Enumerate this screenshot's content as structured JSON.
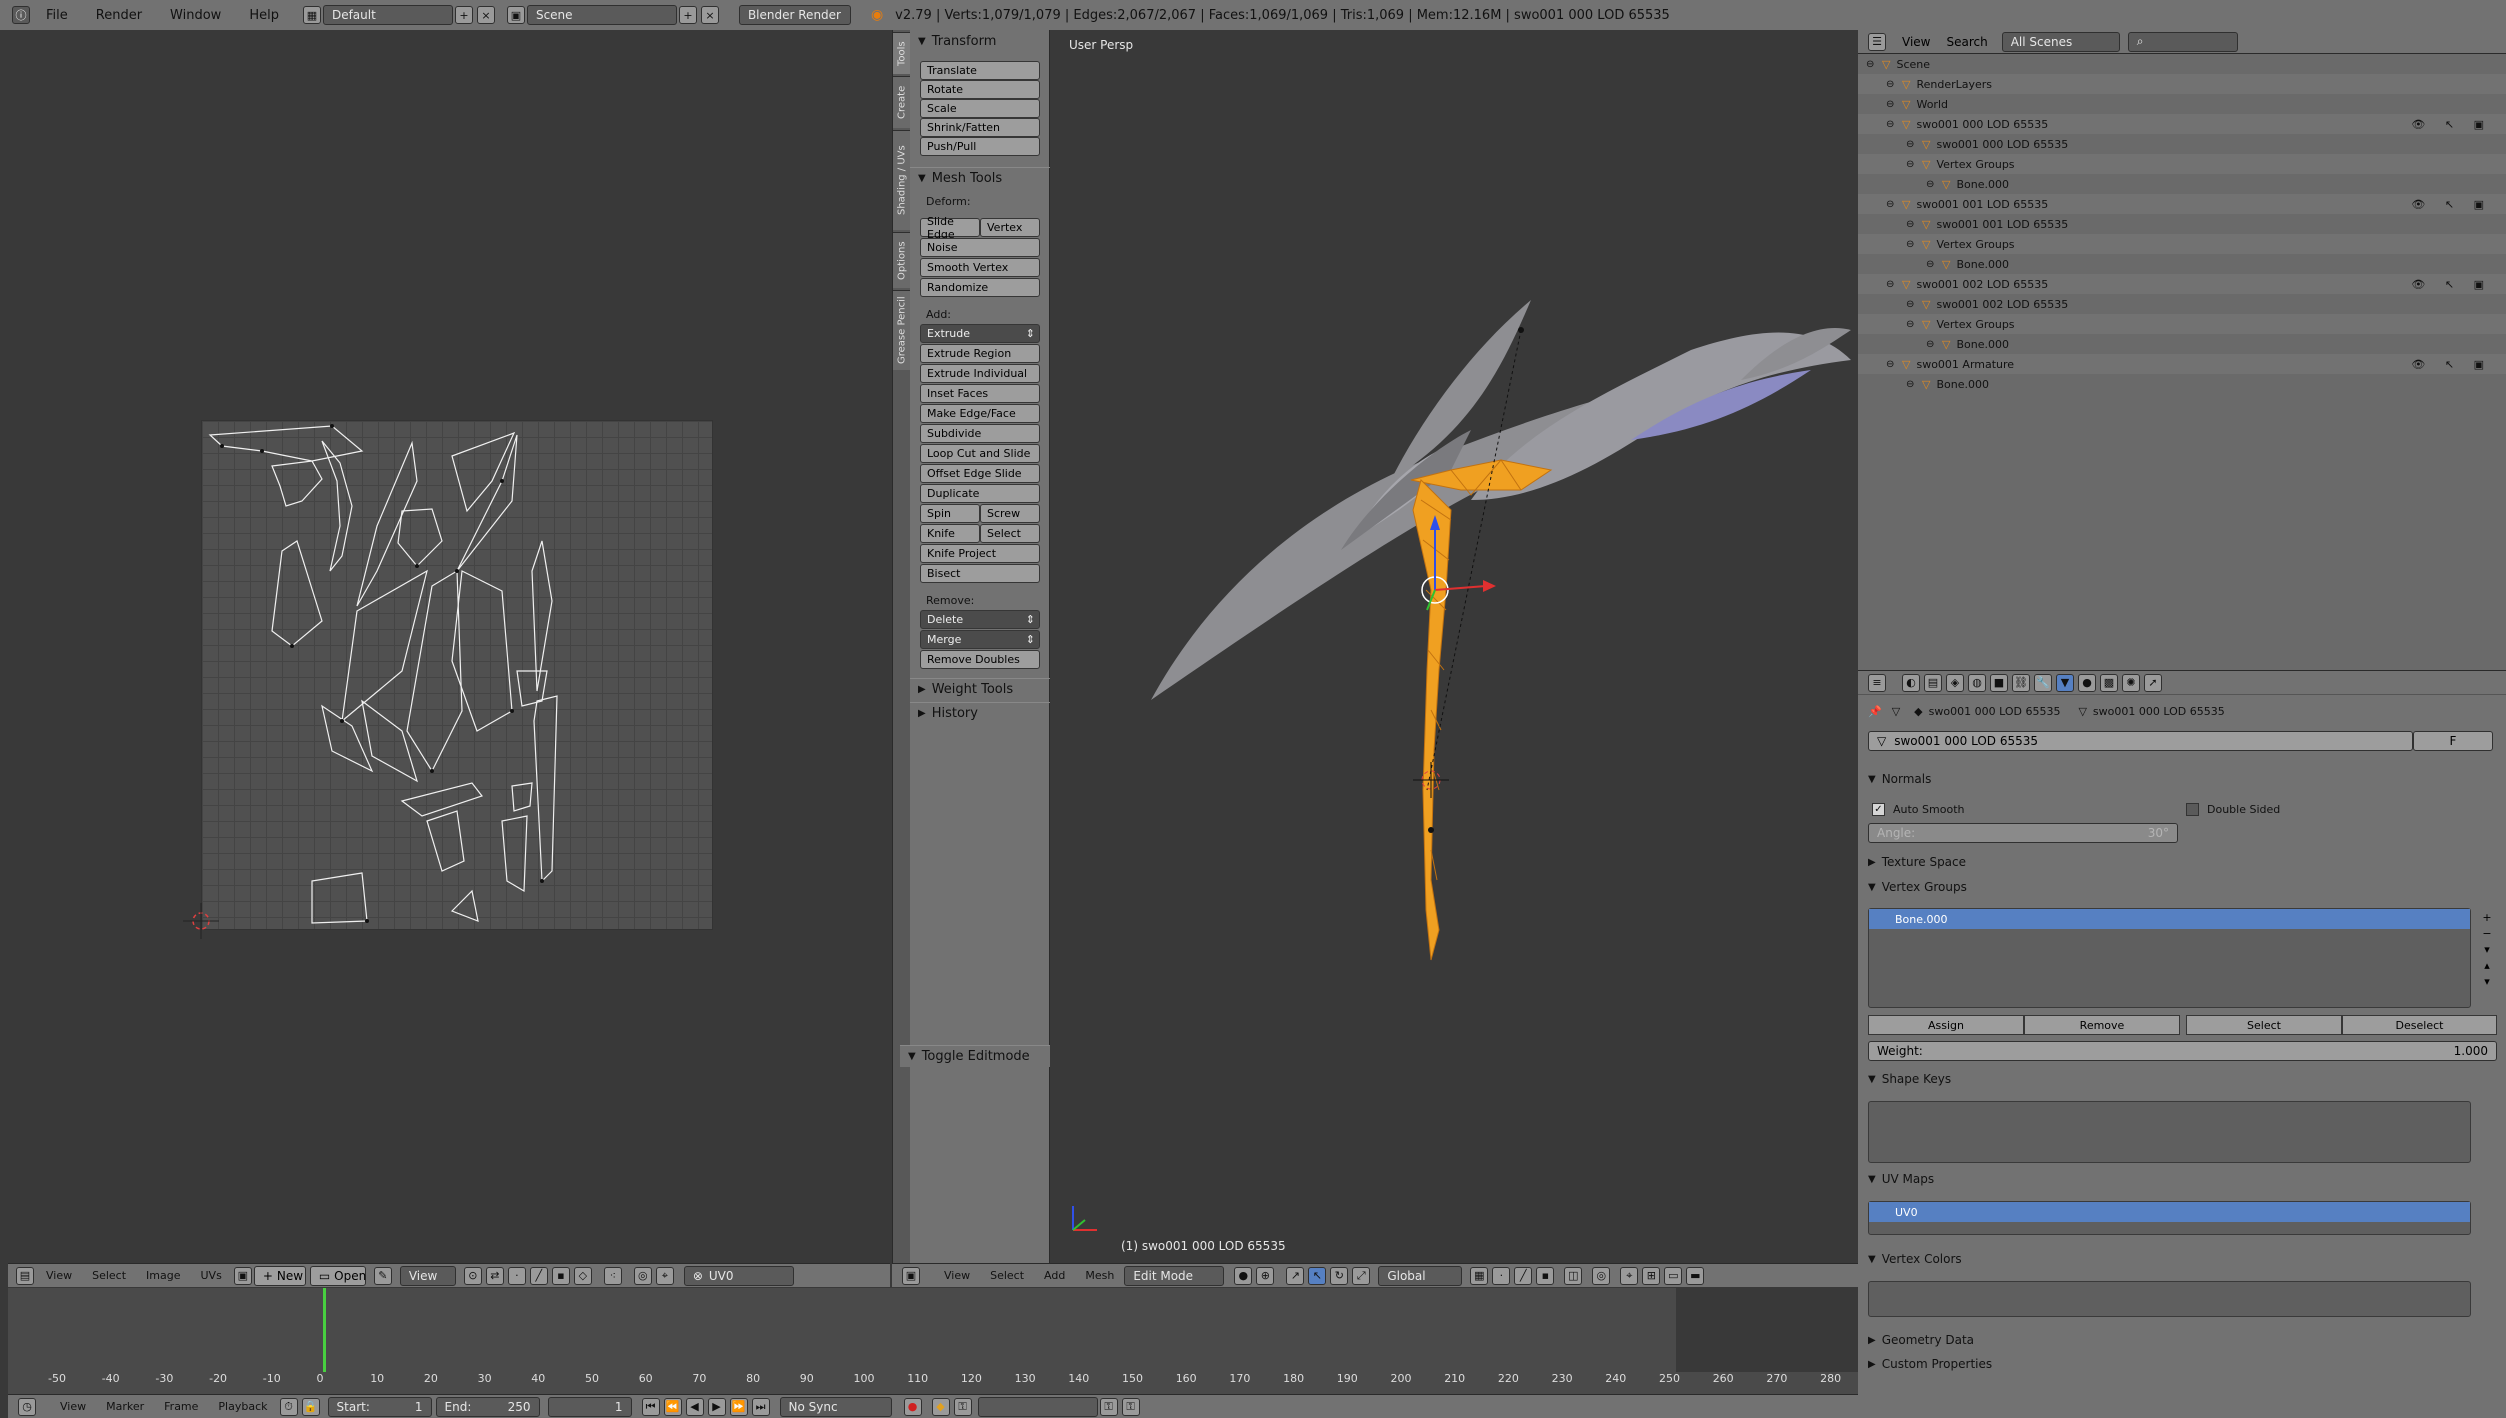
{
  "topbar": {
    "menus": [
      "File",
      "Render",
      "Window",
      "Help"
    ],
    "layout": "Default",
    "scene": "Scene",
    "engine": "Blender Render",
    "stats": "v2.79 | Verts:1,079/1,079 | Edges:2,067/2,067 | Faces:1,069/1,069 | Tris:1,069 | Mem:12.16M | swo001 000 LOD 65535"
  },
  "toolshelf": {
    "tabs": [
      "Tools",
      "Create",
      "Shading / UVs",
      "Options",
      "Grease Pencil"
    ],
    "transform": {
      "title": "Transform",
      "buttons": [
        "Translate",
        "Rotate",
        "Scale",
        "Shrink/Fatten",
        "Push/Pull"
      ]
    },
    "mesh_tools": {
      "title": "Mesh Tools",
      "deform_label": "Deform:",
      "slide_edge": "Slide Edge",
      "vertex": "Vertex",
      "deform": [
        "Noise",
        "Smooth Vertex",
        "Randomize"
      ],
      "add_label": "Add:",
      "extrude": "Extrude",
      "add": [
        "Extrude Region",
        "Extrude Individual",
        "Inset Faces",
        "Make Edge/Face",
        "Subdivide",
        "Loop Cut and Slide",
        "Offset Edge Slide",
        "Duplicate"
      ],
      "spin": "Spin",
      "screw": "Screw",
      "knife": "Knife",
      "select": "Select",
      "add2": [
        "Knife Project",
        "Bisect"
      ],
      "remove_label": "Remove:",
      "delete": "Delete",
      "merge": "Merge",
      "remove_doubles": "Remove Doubles"
    },
    "weight_tools": "Weight Tools",
    "history": "History",
    "toggle_editmode": "Toggle Editmode"
  },
  "view3d": {
    "label": "User Persp",
    "object_label": "(1) swo001 000 LOD 65535"
  },
  "outliner": {
    "header": {
      "view": "View",
      "search": "Search",
      "filter": "All Scenes"
    },
    "rows": [
      {
        "label": "Scene",
        "indent": 0
      },
      {
        "label": "RenderLayers",
        "indent": 1
      },
      {
        "label": "World",
        "indent": 1
      },
      {
        "label": "swo001 000 LOD 65535",
        "indent": 1
      },
      {
        "label": "swo001 000 LOD 65535",
        "indent": 2
      },
      {
        "label": "Vertex Groups",
        "indent": 2
      },
      {
        "label": "Bone.000",
        "indent": 3
      },
      {
        "label": "swo001 001 LOD 65535",
        "indent": 1
      },
      {
        "label": "swo001 001 LOD 65535",
        "indent": 2
      },
      {
        "label": "Vertex Groups",
        "indent": 2
      },
      {
        "label": "Bone.000",
        "indent": 3
      },
      {
        "label": "swo001 002 LOD 65535",
        "indent": 1
      },
      {
        "label": "swo001 002 LOD 65535",
        "indent": 2
      },
      {
        "label": "Vertex Groups",
        "indent": 2
      },
      {
        "label": "Bone.000",
        "indent": 3
      },
      {
        "label": "swo001 Armature",
        "indent": 1
      },
      {
        "label": "Bone.000",
        "indent": 2
      }
    ]
  },
  "properties": {
    "breadcrumb_object": "swo001 000 LOD 65535",
    "breadcrumb_mesh": "swo001 000 LOD 65535",
    "mesh_name": "swo001 000 LOD 65535",
    "fake_user": "F",
    "normals": "Normals",
    "auto_smooth": "Auto Smooth",
    "double_sided": "Double Sided",
    "angle_label": "Angle:",
    "angle_value": "30°",
    "texture_space": "Texture Space",
    "vertex_groups": "Vertex Groups",
    "vg_item": "Bone.000",
    "assign": "Assign",
    "remove": "Remove",
    "select": "Select",
    "deselect": "Deselect",
    "weight_label": "Weight:",
    "weight_value": "1.000",
    "shape_keys": "Shape Keys",
    "uv_maps": "UV Maps",
    "uv_item": "UV0",
    "vertex_colors": "Vertex Colors",
    "geometry_data": "Geometry Data",
    "custom_properties": "Custom Properties"
  },
  "uv_header": {
    "menus": [
      "View",
      "Select",
      "Image",
      "UVs"
    ],
    "new": "New",
    "open": "Open",
    "view": "View",
    "uvmap": "UV0"
  },
  "view3d_header": {
    "menus": [
      "View",
      "Select",
      "Add",
      "Mesh"
    ],
    "mode": "Edit Mode",
    "orientation": "Global"
  },
  "timeline": {
    "ticks": [
      "-50",
      "-40",
      "-30",
      "-20",
      "-10",
      "0",
      "10",
      "20",
      "30",
      "40",
      "50",
      "60",
      "70",
      "80",
      "90",
      "100",
      "110",
      "120",
      "130",
      "140",
      "150",
      "160",
      "170",
      "180",
      "190",
      "200",
      "210",
      "220",
      "230",
      "240",
      "250",
      "260",
      "270",
      "280"
    ],
    "menus": [
      "View",
      "Marker",
      "Frame",
      "Playback"
    ],
    "start": "Start:",
    "start_val": "1",
    "end": "End:",
    "end_val": "250",
    "current": "1",
    "sync": "No Sync"
  }
}
